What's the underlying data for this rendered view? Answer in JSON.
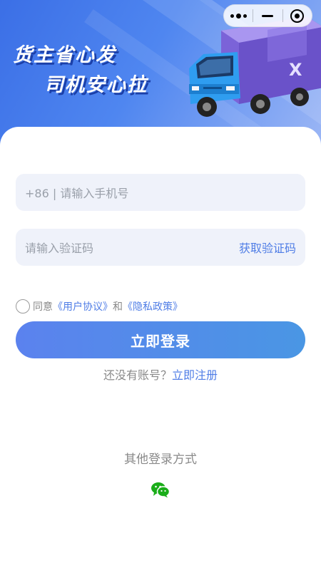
{
  "banner": {
    "slogan_line1": "货主省心发",
    "slogan_line2": "司机安心拉",
    "truck_badge": "X"
  },
  "capsule": {
    "more_icon": "more-dots-icon",
    "minimize_icon": "minimize-icon",
    "close_icon": "circle-target-icon"
  },
  "form": {
    "phone_placeholder": "+86 | 请输入手机号",
    "code_placeholder": "请输入验证码",
    "get_code_label": "获取验证码",
    "agreement_prefix": "同意",
    "user_agreement": "《用户协议》",
    "agreement_and": "和",
    "privacy_policy": "《隐私政策》",
    "login_label": "立即登录",
    "no_account_text": "还没有账号？",
    "register_label": "立即注册",
    "other_login_label": "其他登录方式"
  },
  "colors": {
    "accent": "#4f7de6",
    "banner": "#3b6fe6",
    "wechat": "#1aad19",
    "input_bg": "#eff2fa"
  }
}
